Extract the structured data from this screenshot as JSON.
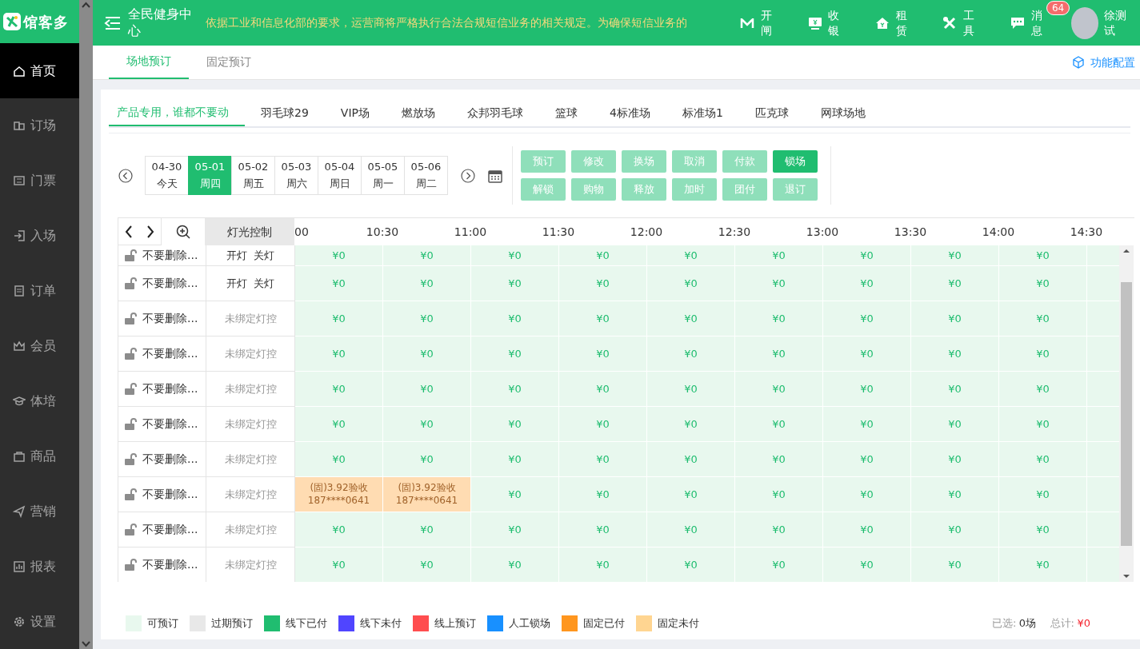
{
  "app": {
    "logo": "馆客多"
  },
  "sidebar": {
    "items": [
      {
        "label": "首页",
        "selected": true
      },
      {
        "label": "订场",
        "selected": false
      },
      {
        "label": "门票",
        "selected": false
      },
      {
        "label": "入场",
        "selected": false
      },
      {
        "label": "订单",
        "selected": false
      },
      {
        "label": "会员",
        "selected": false
      },
      {
        "label": "体培",
        "selected": false
      },
      {
        "label": "商品",
        "selected": false
      },
      {
        "label": "营销",
        "selected": false
      },
      {
        "label": "报表",
        "selected": false
      },
      {
        "label": "设置",
        "selected": false
      }
    ]
  },
  "header": {
    "title": "全民健身中心",
    "notice": "依据工业和信息化部的要求，运营商将严格执行合法合规短信业务的相关规定。为确保短信业务的",
    "actions": [
      {
        "label": "开闸"
      },
      {
        "label": "收银"
      },
      {
        "label": "租赁"
      },
      {
        "label": "工具"
      },
      {
        "label": "消息",
        "badge": "64"
      }
    ],
    "user": {
      "name": "徐测试"
    }
  },
  "page_tabs": [
    {
      "label": "场地预订",
      "selected": true
    },
    {
      "label": "固定预订",
      "selected": false
    }
  ],
  "config_link": "功能配置",
  "venue_tabs": [
    {
      "label": "产品专用，谁都不要动",
      "selected": true
    },
    {
      "label": "羽毛球29",
      "selected": false
    },
    {
      "label": "VIP场",
      "selected": false
    },
    {
      "label": "燃放场",
      "selected": false
    },
    {
      "label": "众邦羽毛球",
      "selected": false
    },
    {
      "label": "篮球",
      "selected": false
    },
    {
      "label": "4标准场",
      "selected": false
    },
    {
      "label": "标准场1",
      "selected": false
    },
    {
      "label": "匹克球",
      "selected": false
    },
    {
      "label": "网球场地",
      "selected": false
    }
  ],
  "dates": [
    {
      "date": "04-30",
      "weekday": "今天",
      "selected": false
    },
    {
      "date": "05-01",
      "weekday": "周四",
      "selected": true
    },
    {
      "date": "05-02",
      "weekday": "周五",
      "selected": false
    },
    {
      "date": "05-03",
      "weekday": "周六",
      "selected": false
    },
    {
      "date": "05-04",
      "weekday": "周日",
      "selected": false
    },
    {
      "date": "05-05",
      "weekday": "周一",
      "selected": false
    },
    {
      "date": "05-06",
      "weekday": "周二",
      "selected": false
    }
  ],
  "actions": [
    {
      "label": "预订",
      "disabled": true
    },
    {
      "label": "修改",
      "disabled": true
    },
    {
      "label": "换场",
      "disabled": true
    },
    {
      "label": "取消",
      "disabled": true
    },
    {
      "label": "付款",
      "disabled": true
    },
    {
      "label": "锁场",
      "disabled": false
    },
    {
      "label": "解锁",
      "disabled": true
    },
    {
      "label": "购物",
      "disabled": true
    },
    {
      "label": "释放",
      "disabled": true
    },
    {
      "label": "加时",
      "disabled": true
    },
    {
      "label": "团付",
      "disabled": true
    },
    {
      "label": "退订",
      "disabled": true
    }
  ],
  "grid": {
    "light_header": "灯光控制",
    "times": [
      "00",
      "10:30",
      "11:00",
      "11:30",
      "12:00",
      "12:30",
      "13:00",
      "13:30",
      "14:00",
      "14:30"
    ],
    "rows": [
      {
        "name": "不要删除...",
        "locked": false,
        "light": {
          "kind": "switch",
          "on_label": "开灯",
          "off_label": "关灯"
        },
        "cells": [
          {
            "kind": "free",
            "text": "¥0"
          },
          {
            "kind": "free",
            "text": "¥0"
          },
          {
            "kind": "free",
            "text": "¥0"
          },
          {
            "kind": "free",
            "text": "¥0"
          },
          {
            "kind": "free",
            "text": "¥0"
          },
          {
            "kind": "free",
            "text": "¥0"
          },
          {
            "kind": "free",
            "text": "¥0"
          },
          {
            "kind": "free",
            "text": "¥0"
          },
          {
            "kind": "free",
            "text": "¥0"
          }
        ]
      },
      {
        "name": "不要删除...",
        "locked": false,
        "light": {
          "kind": "switch",
          "on_label": "开灯",
          "off_label": "关灯"
        },
        "cells": [
          {
            "kind": "free",
            "text": "¥0"
          },
          {
            "kind": "free",
            "text": "¥0"
          },
          {
            "kind": "free",
            "text": "¥0"
          },
          {
            "kind": "free",
            "text": "¥0"
          },
          {
            "kind": "free",
            "text": "¥0"
          },
          {
            "kind": "free",
            "text": "¥0"
          },
          {
            "kind": "free",
            "text": "¥0"
          },
          {
            "kind": "free",
            "text": "¥0"
          },
          {
            "kind": "free",
            "text": "¥0"
          }
        ]
      },
      {
        "name": "不要删除...",
        "locked": false,
        "light": {
          "kind": "unbound",
          "text": "未绑定灯控"
        },
        "cells": [
          {
            "kind": "free",
            "text": "¥0"
          },
          {
            "kind": "free",
            "text": "¥0"
          },
          {
            "kind": "free",
            "text": "¥0"
          },
          {
            "kind": "free",
            "text": "¥0"
          },
          {
            "kind": "free",
            "text": "¥0"
          },
          {
            "kind": "free",
            "text": "¥0"
          },
          {
            "kind": "free",
            "text": "¥0"
          },
          {
            "kind": "free",
            "text": "¥0"
          },
          {
            "kind": "free",
            "text": "¥0"
          }
        ]
      },
      {
        "name": "不要删除...",
        "locked": false,
        "light": {
          "kind": "unbound",
          "text": "未绑定灯控"
        },
        "cells": [
          {
            "kind": "free",
            "text": "¥0"
          },
          {
            "kind": "free",
            "text": "¥0"
          },
          {
            "kind": "free",
            "text": "¥0"
          },
          {
            "kind": "free",
            "text": "¥0"
          },
          {
            "kind": "free",
            "text": "¥0"
          },
          {
            "kind": "free",
            "text": "¥0"
          },
          {
            "kind": "free",
            "text": "¥0"
          },
          {
            "kind": "free",
            "text": "¥0"
          },
          {
            "kind": "free",
            "text": "¥0"
          }
        ]
      },
      {
        "name": "不要删除...",
        "locked": false,
        "light": {
          "kind": "unbound",
          "text": "未绑定灯控"
        },
        "cells": [
          {
            "kind": "free",
            "text": "¥0"
          },
          {
            "kind": "free",
            "text": "¥0"
          },
          {
            "kind": "free",
            "text": "¥0"
          },
          {
            "kind": "free",
            "text": "¥0"
          },
          {
            "kind": "free",
            "text": "¥0"
          },
          {
            "kind": "free",
            "text": "¥0"
          },
          {
            "kind": "free",
            "text": "¥0"
          },
          {
            "kind": "free",
            "text": "¥0"
          },
          {
            "kind": "free",
            "text": "¥0"
          }
        ]
      },
      {
        "name": "不要删除...",
        "locked": false,
        "light": {
          "kind": "unbound",
          "text": "未绑定灯控"
        },
        "cells": [
          {
            "kind": "free",
            "text": "¥0"
          },
          {
            "kind": "free",
            "text": "¥0"
          },
          {
            "kind": "free",
            "text": "¥0"
          },
          {
            "kind": "free",
            "text": "¥0"
          },
          {
            "kind": "free",
            "text": "¥0"
          },
          {
            "kind": "free",
            "text": "¥0"
          },
          {
            "kind": "free",
            "text": "¥0"
          },
          {
            "kind": "free",
            "text": "¥0"
          },
          {
            "kind": "free",
            "text": "¥0"
          }
        ]
      },
      {
        "name": "不要删除...",
        "locked": false,
        "light": {
          "kind": "unbound",
          "text": "未绑定灯控"
        },
        "cells": [
          {
            "kind": "free",
            "text": "¥0"
          },
          {
            "kind": "free",
            "text": "¥0"
          },
          {
            "kind": "free",
            "text": "¥0"
          },
          {
            "kind": "free",
            "text": "¥0"
          },
          {
            "kind": "free",
            "text": "¥0"
          },
          {
            "kind": "free",
            "text": "¥0"
          },
          {
            "kind": "free",
            "text": "¥0"
          },
          {
            "kind": "free",
            "text": "¥0"
          },
          {
            "kind": "free",
            "text": "¥0"
          }
        ]
      },
      {
        "name": "不要删除...",
        "locked": false,
        "light": {
          "kind": "unbound",
          "text": "未绑定灯控"
        },
        "cells": [
          {
            "kind": "fixed_unpaid",
            "label": "(固)3.92验收",
            "phone": "187****0641"
          },
          {
            "kind": "fixed_unpaid",
            "label": "(固)3.92验收",
            "phone": "187****0641"
          },
          {
            "kind": "free",
            "text": "¥0"
          },
          {
            "kind": "free",
            "text": "¥0"
          },
          {
            "kind": "free",
            "text": "¥0"
          },
          {
            "kind": "free",
            "text": "¥0"
          },
          {
            "kind": "free",
            "text": "¥0"
          },
          {
            "kind": "free",
            "text": "¥0"
          },
          {
            "kind": "free",
            "text": "¥0"
          }
        ]
      },
      {
        "name": "不要删除...",
        "locked": false,
        "light": {
          "kind": "unbound",
          "text": "未绑定灯控"
        },
        "cells": [
          {
            "kind": "free",
            "text": "¥0"
          },
          {
            "kind": "free",
            "text": "¥0"
          },
          {
            "kind": "free",
            "text": "¥0"
          },
          {
            "kind": "free",
            "text": "¥0"
          },
          {
            "kind": "free",
            "text": "¥0"
          },
          {
            "kind": "free",
            "text": "¥0"
          },
          {
            "kind": "free",
            "text": "¥0"
          },
          {
            "kind": "free",
            "text": "¥0"
          },
          {
            "kind": "free",
            "text": "¥0"
          }
        ]
      },
      {
        "name": "不要删除...",
        "locked": false,
        "light": {
          "kind": "unbound",
          "text": "未绑定灯控"
        },
        "cells": [
          {
            "kind": "free",
            "text": "¥0"
          },
          {
            "kind": "free",
            "text": "¥0"
          },
          {
            "kind": "free",
            "text": "¥0"
          },
          {
            "kind": "free",
            "text": "¥0"
          },
          {
            "kind": "free",
            "text": "¥0"
          },
          {
            "kind": "free",
            "text": "¥0"
          },
          {
            "kind": "free",
            "text": "¥0"
          },
          {
            "kind": "free",
            "text": "¥0"
          },
          {
            "kind": "free",
            "text": "¥0"
          }
        ]
      }
    ]
  },
  "legend": [
    {
      "label": "可预订",
      "color": "#e8f8ee"
    },
    {
      "label": "过期预订",
      "color": "#e8e8e8"
    },
    {
      "label": "线下已付",
      "color": "#20bd70"
    },
    {
      "label": "线下未付",
      "color": "#5045ff"
    },
    {
      "label": "线上预订",
      "color": "#ff4d4f"
    },
    {
      "label": "人工锁场",
      "color": "#1890ff"
    },
    {
      "label": "固定已付",
      "color": "#ff961e"
    },
    {
      "label": "固定未付",
      "color": "#ffd591"
    }
  ],
  "summary": {
    "selected_label": "已选:",
    "selected_value": "0场",
    "total_label": "总计:",
    "total_value": "¥0"
  }
}
